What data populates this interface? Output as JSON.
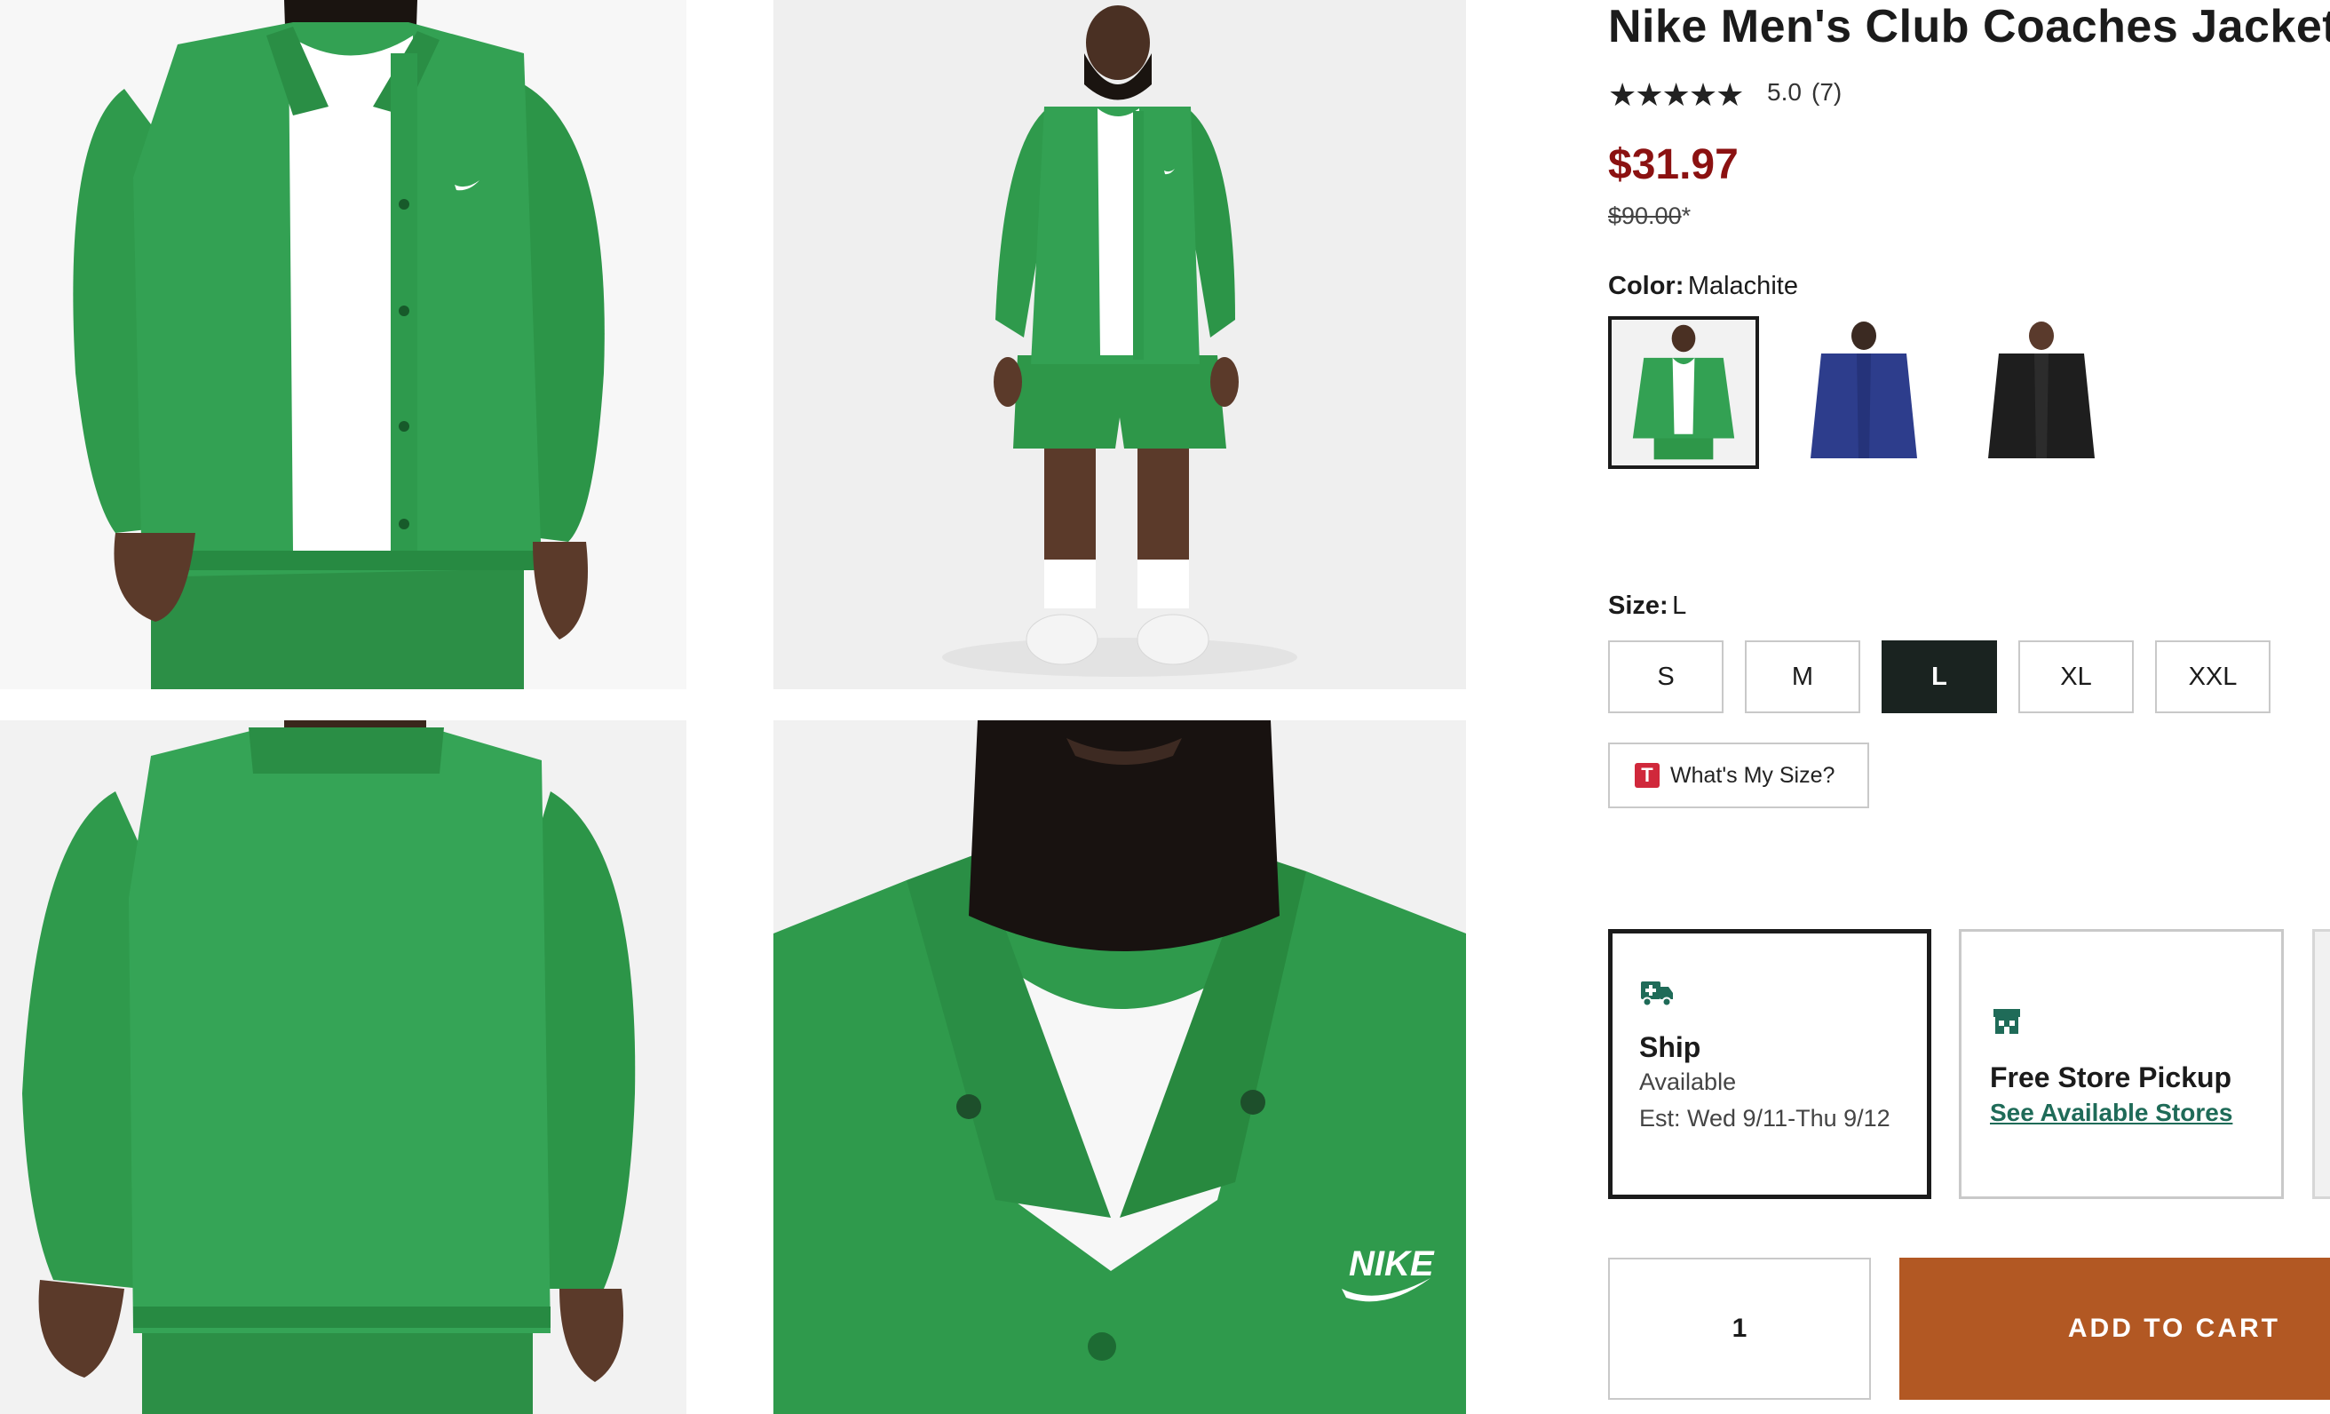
{
  "product": {
    "title": "Nike Men's Club Coaches Jacket",
    "stars": "★★★★★",
    "rating": "5.0",
    "review_count": "(7)",
    "price": "$31.97",
    "original_price": "$90.00",
    "original_price_mark": "*"
  },
  "color": {
    "label": "Color:",
    "selected": "Malachite",
    "options": [
      "Malachite",
      "Navy",
      "Black"
    ]
  },
  "size": {
    "label": "Size:",
    "selected": "L",
    "options": [
      "S",
      "M",
      "L",
      "XL",
      "XXL"
    ]
  },
  "size_help": {
    "icon_letter": "T",
    "label": "What's My Size?"
  },
  "fulfillment": {
    "ship": {
      "title": "Ship",
      "status": "Available",
      "estimate": "Est: Wed 9/11-Thu 9/12"
    },
    "pickup": {
      "title": "Free Store Pickup",
      "link": "See Available Stores"
    }
  },
  "cart": {
    "quantity": "1",
    "button_label": "ADD TO CART"
  },
  "colors": {
    "price_red": "#8b1111",
    "jacket_green": "#2f9a4c",
    "cart_orange": "#b25823",
    "link_green": "#1f6b58",
    "selected_size_bg": "#1a2320"
  }
}
